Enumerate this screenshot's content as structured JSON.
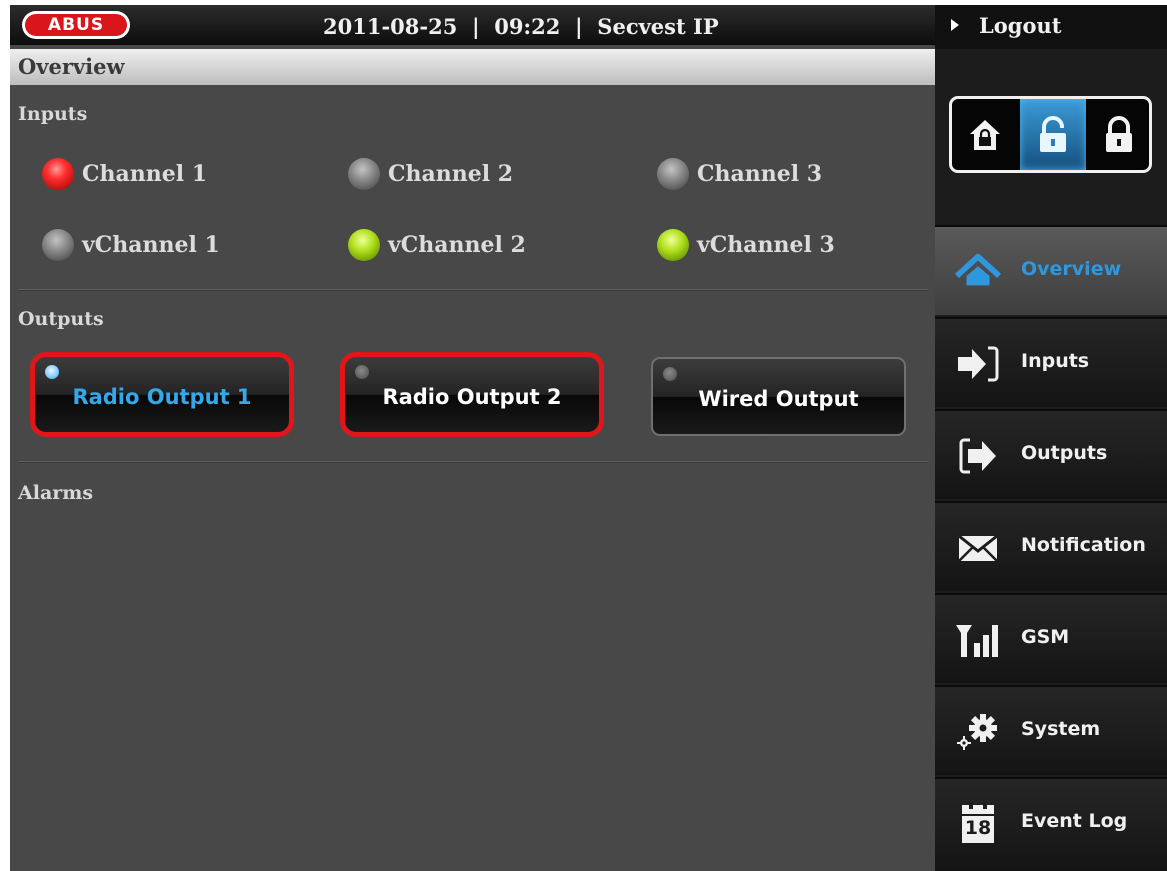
{
  "header": {
    "brand": "ABUS",
    "status_line": "2011-08-25  |  09:22  |  Secvest IP"
  },
  "page": {
    "title": "Overview"
  },
  "inputs": {
    "label": "Inputs",
    "channels": [
      {
        "label": "Channel 1",
        "status": "red"
      },
      {
        "label": "Channel 2",
        "status": "grey"
      },
      {
        "label": "Channel 3",
        "status": "grey"
      },
      {
        "label": "vChannel 1",
        "status": "grey"
      },
      {
        "label": "vChannel 2",
        "status": "green"
      },
      {
        "label": "vChannel 3",
        "status": "green"
      }
    ]
  },
  "outputs": {
    "label": "Outputs",
    "buttons": [
      {
        "label": "Radio Output 1",
        "active": true,
        "highlighted": true
      },
      {
        "label": "Radio Output 2",
        "active": false,
        "highlighted": true
      },
      {
        "label": "Wired Output",
        "active": false,
        "highlighted": false
      }
    ]
  },
  "alarms": {
    "label": "Alarms"
  },
  "sidebar": {
    "logout_label": "Logout",
    "arm_states": [
      {
        "icon": "house-lock-icon",
        "selected": false
      },
      {
        "icon": "unlocked-padlock-icon",
        "selected": true
      },
      {
        "icon": "locked-padlock-icon",
        "selected": false
      }
    ],
    "items": [
      {
        "label": "Overview",
        "icon": "home-icon",
        "active": true
      },
      {
        "label": "Inputs",
        "icon": "input-arrow-icon",
        "active": false
      },
      {
        "label": "Outputs",
        "icon": "output-arrow-icon",
        "active": false
      },
      {
        "label": "Notification",
        "icon": "envelope-icon",
        "active": false
      },
      {
        "label": "GSM",
        "icon": "signal-bars-icon",
        "active": false
      },
      {
        "label": "System",
        "icon": "gears-icon",
        "active": false
      },
      {
        "label": "Event Log",
        "icon": "calendar-icon",
        "active": false
      }
    ],
    "calendar_day": "18"
  },
  "colors": {
    "accent_blue": "#2f97de",
    "highlight_red": "#e0161b",
    "brand_red": "#d9161b"
  }
}
